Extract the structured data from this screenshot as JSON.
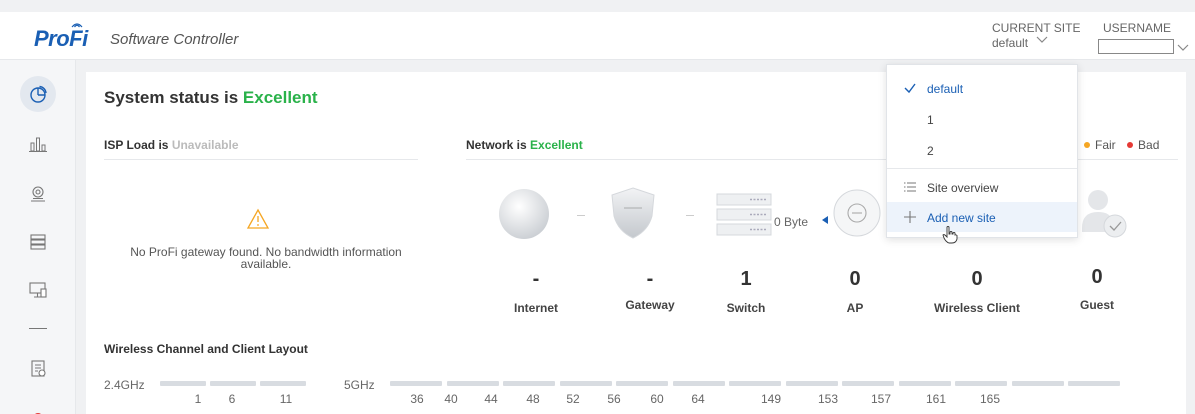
{
  "header": {
    "logo_text": "ProFi",
    "app_title": "Software Controller",
    "current_site_label": "CURRENT SITE",
    "current_site_value": "default",
    "username_label": "USERNAME",
    "username_value": ""
  },
  "sidebar": {
    "items": [
      {
        "icon": "dashboard-pie-icon",
        "active": true
      },
      {
        "icon": "statistics-bars-icon",
        "active": false
      },
      {
        "icon": "map-location-icon",
        "active": false
      },
      {
        "icon": "devices-stack-icon",
        "active": false
      },
      {
        "icon": "clients-monitor-icon",
        "active": false
      },
      {
        "icon": "log-report-icon",
        "active": false
      }
    ]
  },
  "status": {
    "title_prefix": "System status is ",
    "title_value": "Excellent"
  },
  "isp": {
    "label": "ISP Load is ",
    "value": "Unavailable",
    "message": "No ProFi gateway found. No bandwidth information available."
  },
  "network": {
    "label": "Network is ",
    "value": "Excellent",
    "legend": [
      {
        "label": "Fair",
        "color": "#f5a623"
      },
      {
        "label": "Bad",
        "color": "#e53935"
      }
    ],
    "throughput": "0 Byte",
    "nodes": [
      {
        "label": "Internet",
        "value": "-"
      },
      {
        "label": "Gateway",
        "value": "-"
      },
      {
        "label": "Switch",
        "value": "1"
      },
      {
        "label": "AP",
        "value": "0"
      },
      {
        "label": "Wireless Client",
        "value": "0"
      },
      {
        "label": "Guest",
        "value": "0"
      }
    ]
  },
  "wireless": {
    "title": "Wireless Channel and Client Layout",
    "band_24": "2.4GHz",
    "band_5": "5GHz",
    "channels_24": [
      "1",
      "6",
      "11"
    ],
    "channels_5": [
      "36",
      "40",
      "44",
      "48",
      "52",
      "56",
      "60",
      "64",
      "149",
      "153",
      "157",
      "161",
      "165"
    ]
  },
  "site_dropdown": {
    "items": [
      {
        "label": "default",
        "selected": true
      },
      {
        "label": "1",
        "selected": false
      },
      {
        "label": "2",
        "selected": false
      }
    ],
    "overview_label": "Site overview",
    "add_label": "Add new site"
  },
  "colors": {
    "brand": "#1a5fb4",
    "excellent": "#2ab24a",
    "fair": "#f5a623",
    "bad": "#e53935"
  }
}
